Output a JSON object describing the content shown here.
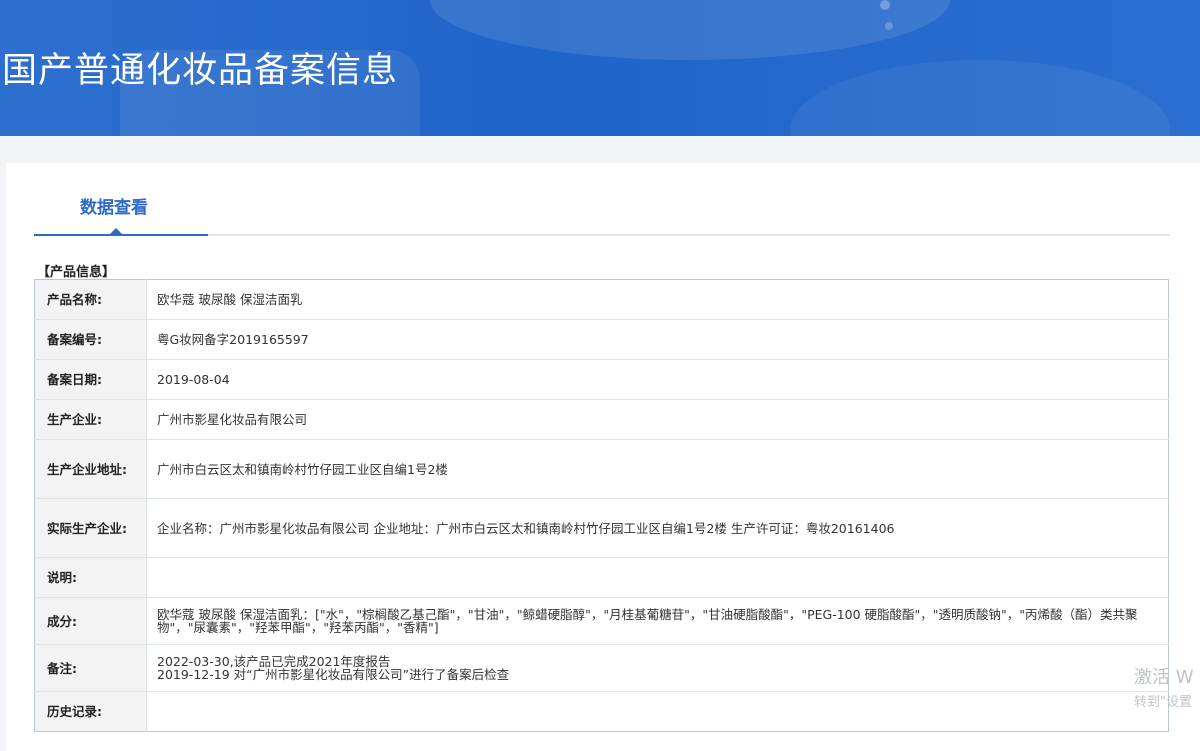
{
  "header": {
    "title": "国产普通化妆品备案信息"
  },
  "tabs": [
    {
      "label": "数据查看",
      "active": true
    }
  ],
  "section": {
    "title": "【产品信息】"
  },
  "rows": [
    {
      "label": "产品名称:",
      "value": "欧华蔻 玻尿酸 保湿洁面乳"
    },
    {
      "label": "备案编号:",
      "value": "粤G妆网备字2019165597"
    },
    {
      "label": "备案日期:",
      "value": "2019-08-04"
    },
    {
      "label": "生产企业:",
      "value": "广州市影星化妆品有限公司"
    },
    {
      "label": "生产企业地址:",
      "value": "广州市白云区太和镇南岭村竹仔园工业区自编1号2楼"
    },
    {
      "label": "实际生产企业:",
      "value": "企业名称：广州市影星化妆品有限公司 企业地址：广州市白云区太和镇南岭村竹仔园工业区自编1号2楼 生产许可证：粤妆20161406"
    },
    {
      "label": "说明:",
      "value": ""
    },
    {
      "label": "成分:",
      "value": "欧华蔻 玻尿酸 保湿洁面乳：[\"水\"，\"棕榈酸乙基己酯\"，\"甘油\"，\"鲸蜡硬脂醇\"，\"月桂基葡糖苷\"，\"甘油硬脂酸酯\"，\"PEG-100 硬脂酸酯\"，\"透明质酸钠\"，\"丙烯酸（酯）类共聚物\"，\"尿囊素\"，\"羟苯甲酯\"，\"羟苯丙酯\"，\"香精\"]"
    },
    {
      "label": "备注:",
      "lines": [
        "2022-03-30,该产品已完成2021年度报告",
        "2019-12-19 对“广州市影星化妆品有限公司”进行了备案后检查"
      ]
    },
    {
      "label": "历史记录:",
      "value": ""
    }
  ],
  "watermark": {
    "line1": "激活 W",
    "line2": "转到\"设置"
  }
}
